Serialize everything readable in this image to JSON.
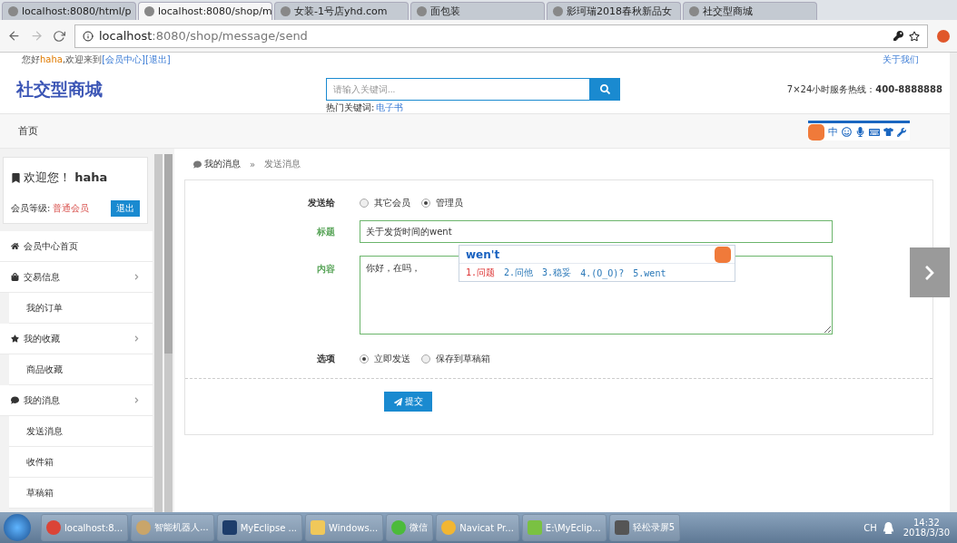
{
  "browser": {
    "tabs": [
      {
        "title": "localhost:8080/html/p",
        "selected": false
      },
      {
        "title": "localhost:8080/shop/m",
        "selected": true
      },
      {
        "title": "女装-1号店yhd.com",
        "selected": false
      },
      {
        "title": "面包装",
        "selected": false
      },
      {
        "title": "影珂瑞2018春秋新品女",
        "selected": false
      },
      {
        "title": "社交型商城",
        "selected": false
      }
    ],
    "url_host": "localhost",
    "url_rest": ":8080/shop/message/send"
  },
  "topbar": {
    "hello": "您好",
    "username": "haha",
    "welcome": ",欢迎来到",
    "links": [
      "[会员中心]",
      "[退出]"
    ],
    "about": "关于我们"
  },
  "header": {
    "logo": "社交型商城",
    "search_placeholder": "请输入关键词...",
    "hot_label": "热门关键词:",
    "hot_link": "电子书",
    "hotline_label": "7×24小时服务热线：",
    "hotline": "400-8888888"
  },
  "nav": [
    "首页"
  ],
  "user_card": {
    "welcome": "欢迎您！",
    "name": "haha",
    "level_label": "会员等级:",
    "level": "普通会员",
    "logout": "退出"
  },
  "sidebar": {
    "items": [
      {
        "label": "会员中心首页"
      },
      {
        "label": "交易信息",
        "children": [
          {
            "label": "我的订单"
          }
        ]
      },
      {
        "label": "我的收藏",
        "children": [
          {
            "label": "商品收藏"
          }
        ]
      },
      {
        "label": "我的消息",
        "children": [
          {
            "label": "发送消息"
          },
          {
            "label": "收件箱"
          },
          {
            "label": "草稿箱"
          }
        ]
      }
    ]
  },
  "breadcrumb": {
    "items": [
      "我的消息",
      "发送消息"
    ],
    "separator": "»"
  },
  "form": {
    "send_to": {
      "label": "发送给",
      "options": [
        {
          "label": "其它会员",
          "selected": false
        },
        {
          "label": "管理员",
          "selected": true
        }
      ]
    },
    "title": {
      "label": "标题",
      "value": "关于发货时间的went"
    },
    "content": {
      "label": "内容",
      "value": "你好，在吗，"
    },
    "options": {
      "label": "选项",
      "options": [
        {
          "label": "立即发送",
          "selected": true
        },
        {
          "label": "保存到草稿箱",
          "selected": false
        }
      ]
    },
    "submit": "提交"
  },
  "ime": {
    "composition": "wen't",
    "candidates": [
      {
        "text": "1.问题",
        "selected": true
      },
      {
        "text": "2.问他",
        "selected": false
      },
      {
        "text": "3.稳妥",
        "selected": false
      },
      {
        "text": "4.(O_O)?",
        "selected": false
      },
      {
        "text": "5.went",
        "selected": false
      }
    ],
    "toolbar_mode": "中"
  },
  "taskbar": {
    "items": [
      {
        "label": "localhost:8..."
      },
      {
        "label": "智能机器人..."
      },
      {
        "label": "MyEclipse ..."
      },
      {
        "label": "Windows..."
      },
      {
        "label": "微信"
      },
      {
        "label": "Navicat Pr..."
      },
      {
        "label": "E:\\MyEclip..."
      },
      {
        "label": "轻松录屏5"
      }
    ],
    "lang": "CH",
    "time": "14:32",
    "date": "2018/3/30"
  }
}
